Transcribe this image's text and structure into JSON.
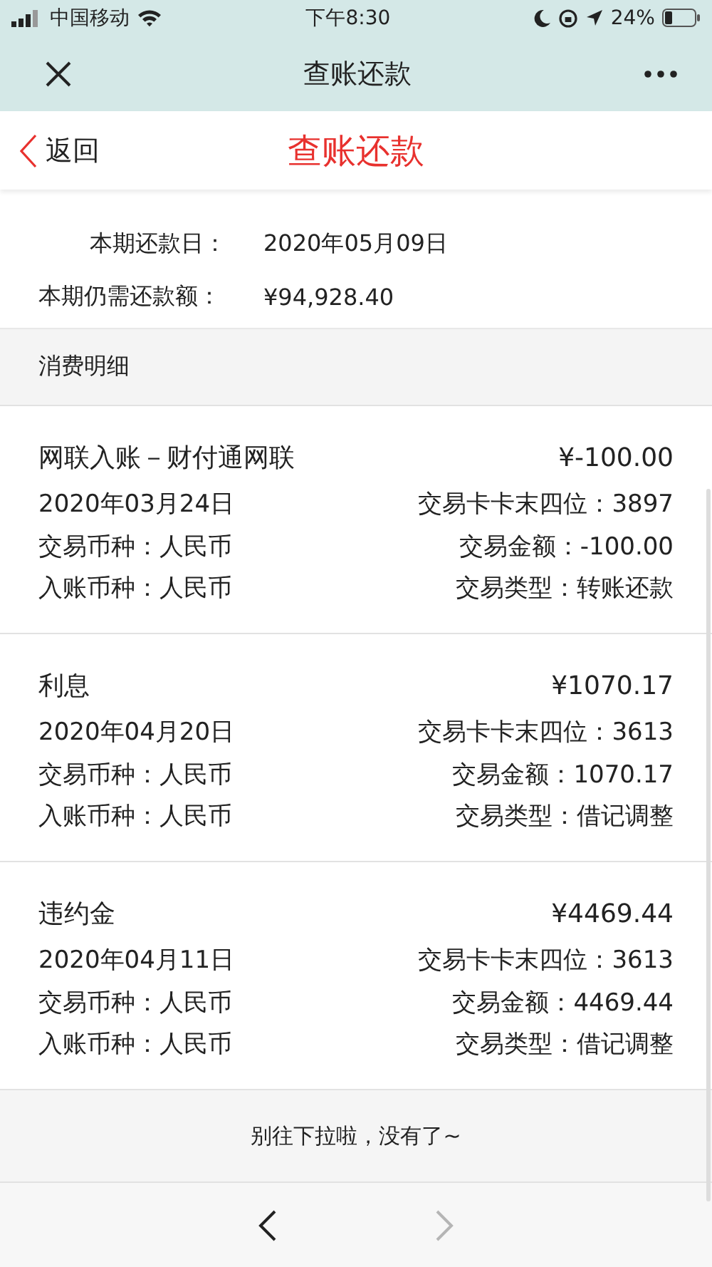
{
  "status_bar": {
    "carrier": "中国移动",
    "time": "下午8:30",
    "battery": "24%"
  },
  "window": {
    "title": "查账还款"
  },
  "header": {
    "back": "返回",
    "title": "查账还款"
  },
  "summary": [
    {
      "label": "本期还款日：",
      "value": "2020年05月09日",
      "indent": true
    },
    {
      "label": "本期仍需还款额：",
      "value": "¥94,928.40",
      "indent": false
    }
  ],
  "section_title": "消费明细",
  "transactions": [
    {
      "name": "网联入账－财付通网联",
      "amount": "¥-100.00",
      "date": "2020年03月24日",
      "card": "交易卡卡末四位：3897",
      "currency": "交易币种：人民币",
      "tx_amount": "交易金额：-100.00",
      "post_currency": "入账币种：人民币",
      "type": "交易类型：转账还款"
    },
    {
      "name": "利息",
      "amount": "¥1070.17",
      "date": "2020年04月20日",
      "card": "交易卡卡末四位：3613",
      "currency": "交易币种：人民币",
      "tx_amount": "交易金额：1070.17",
      "post_currency": "入账币种：人民币",
      "type": "交易类型：借记调整"
    },
    {
      "name": "违约金",
      "amount": "¥4469.44",
      "date": "2020年04月11日",
      "card": "交易卡卡末四位：3613",
      "currency": "交易币种：人民币",
      "tx_amount": "交易金额：4469.44",
      "post_currency": "入账币种：人民币",
      "type": "交易类型：借记调整"
    }
  ],
  "end_note": "别往下拉啦，没有了~",
  "toolbar": [
    {
      "kind": "back",
      "disabled": false
    },
    {
      "kind": "forward",
      "disabled": true
    }
  ]
}
